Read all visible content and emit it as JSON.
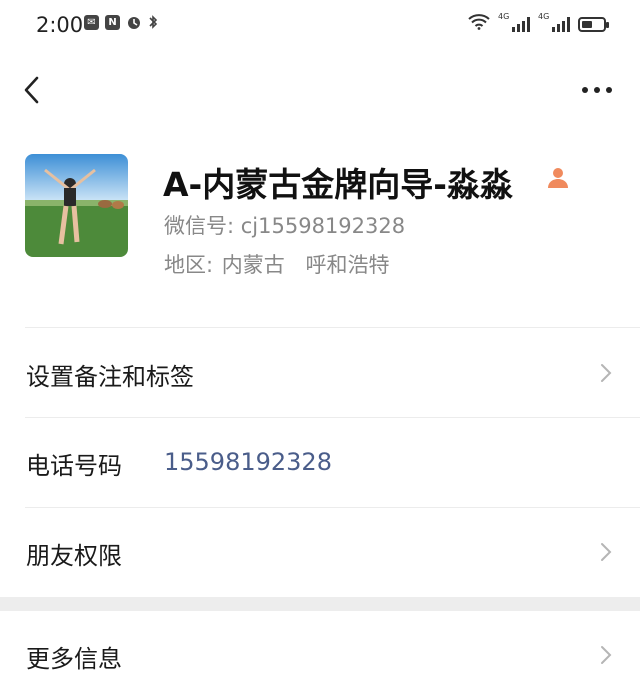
{
  "status_bar": {
    "time": "2:00",
    "left_icons": [
      "message-icon",
      "nfc-icon",
      "alarm-icon",
      "bluetooth-icon"
    ],
    "right_icons": [
      "wifi-icon",
      "signal-4g-icon",
      "signal-4g-icon",
      "battery-icon"
    ],
    "network_1": "4G",
    "network_2": "4G"
  },
  "nav": {
    "back_icon": "chevron-left-icon",
    "more_icon": "more-dots-icon"
  },
  "profile": {
    "name": "A-内蒙古金牌向导-淼淼",
    "wechat_id_label": "微信号:",
    "wechat_id": "cj15598192328",
    "region_label": "地区:",
    "region": "内蒙古",
    "city": "呼和浩特",
    "person_icon_color": "#f08a5d"
  },
  "rows": [
    {
      "label": "设置备注和标签",
      "value": "",
      "chevron": true
    },
    {
      "label": "电话号码",
      "value": "15598192328",
      "chevron": false
    },
    {
      "label": "朋友权限",
      "value": "",
      "chevron": true
    },
    {
      "label": "更多信息",
      "value": "",
      "chevron": true
    }
  ],
  "colors": {
    "link": "#4a5d8a",
    "secondary_text": "#888888",
    "section_gap": "#ededed"
  }
}
